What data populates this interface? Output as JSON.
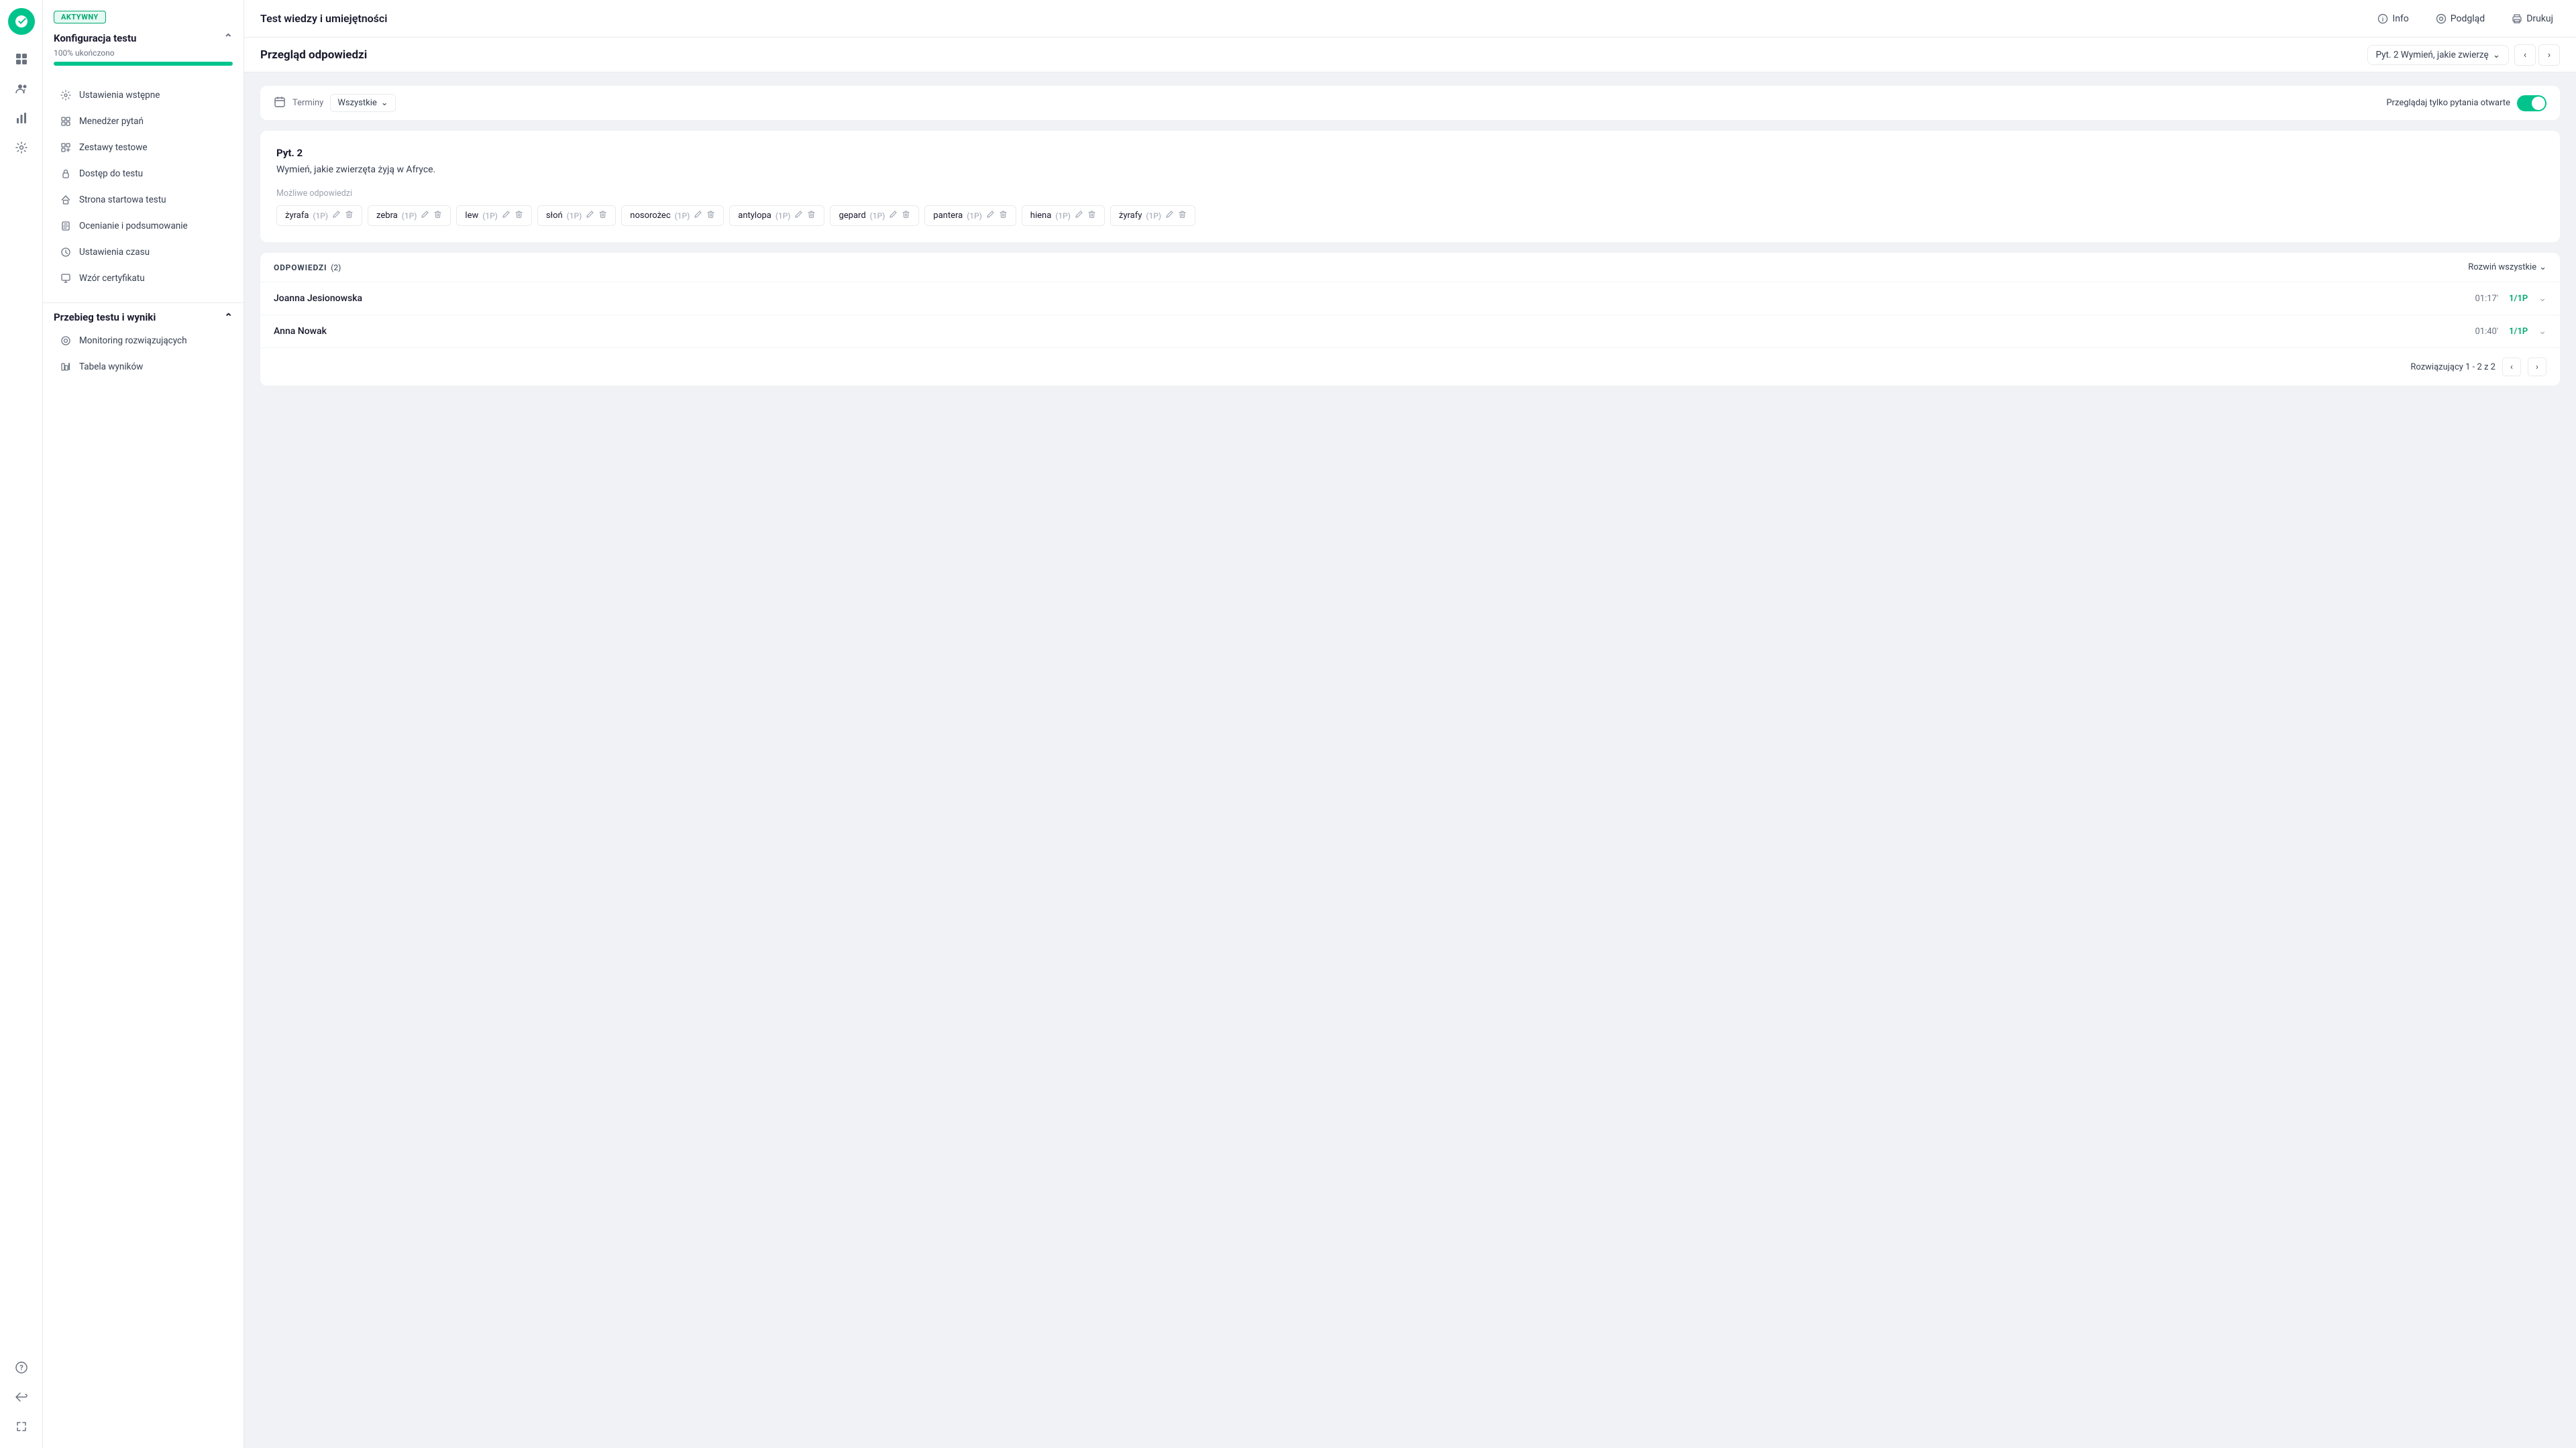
{
  "app": {
    "title": "Test wiedzy i umiejętności"
  },
  "header": {
    "info_label": "Info",
    "preview_label": "Podgląd",
    "print_label": "Drukuj"
  },
  "status": {
    "badge": "AKTYWNY"
  },
  "sidebar": {
    "section1_title": "Konfiguracja testu",
    "progress_label": "100% ukończono",
    "progress_pct": 100,
    "config_items": [
      {
        "id": "ustawienia-wstepne",
        "label": "Ustawienia wstępne",
        "icon": "⚙"
      },
      {
        "id": "menedzer-pytan",
        "label": "Menedżer pytań",
        "icon": "⊞"
      },
      {
        "id": "zestawy-testowe",
        "label": "Zestawy testowe",
        "icon": "⊡"
      },
      {
        "id": "dostep-do-testu",
        "label": "Dostęp do testu",
        "icon": "🔒"
      },
      {
        "id": "strona-startowa",
        "label": "Strona startowa testu",
        "icon": "🏠"
      },
      {
        "id": "ocenianie",
        "label": "Ocenianie i podsumowanie",
        "icon": "📄"
      },
      {
        "id": "ustawienia-czasu",
        "label": "Ustawienia czasu",
        "icon": "🕐"
      },
      {
        "id": "wzor-certyfikatu",
        "label": "Wzór certyfikatu",
        "icon": "📜"
      }
    ],
    "section2_title": "Przebieg testu i wyniki",
    "results_items": [
      {
        "id": "monitoring",
        "label": "Monitoring rozwiązujących",
        "icon": "◎"
      },
      {
        "id": "tabela-wynikow",
        "label": "Tabela wyników",
        "icon": "📊"
      }
    ]
  },
  "content": {
    "page_heading": "Przegląd odpowiedzi",
    "question_selector_label": "Pyt. 2 Wymień, jakie zwierzę",
    "filter": {
      "calendar_icon": "📅",
      "terminy_label": "Terminy",
      "all_label": "Wszystkie",
      "open_only_label": "Przeglądaj tylko pytania otwarte"
    },
    "question": {
      "number": "Pyt. 2",
      "text": "Wymień, jakie zwierzęta żyją w Afryce.",
      "possible_answers_label": "Możliwe odpowiedzi",
      "answers": [
        {
          "text": "żyrafa",
          "points": "(1P)"
        },
        {
          "text": "zebra",
          "points": "(1P)"
        },
        {
          "text": "lew",
          "points": "(1P)"
        },
        {
          "text": "słoń",
          "points": "(1P)"
        },
        {
          "text": "nosorożec",
          "points": "(1P)"
        },
        {
          "text": "antylopa",
          "points": "(1P)"
        },
        {
          "text": "gepard",
          "points": "(1P)"
        },
        {
          "text": "pantera",
          "points": "(1P)"
        },
        {
          "text": "hiena",
          "points": "(1P)"
        },
        {
          "text": "żyrafy",
          "points": "(1P)"
        }
      ]
    },
    "responses": {
      "title": "ODPOWIEDZI",
      "count": "(2)",
      "expand_all": "Rozwiń wszystkie",
      "items": [
        {
          "name": "Joanna Jesionowska",
          "time": "01:17'",
          "score": "1/1P"
        },
        {
          "name": "Anna Nowak",
          "time": "01:40'",
          "score": "1/1P"
        }
      ],
      "pagination_label": "Rozwiązujący 1 - 2 z 2"
    }
  }
}
